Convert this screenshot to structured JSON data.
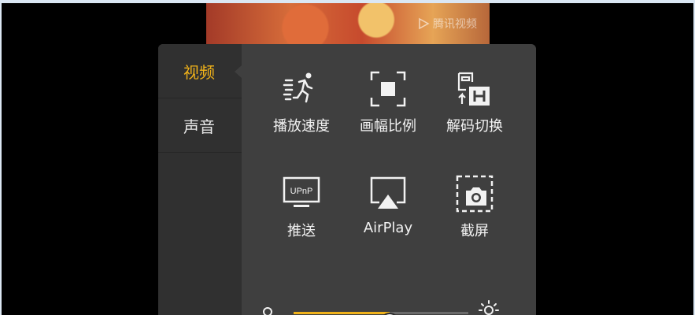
{
  "watermark": {
    "text": "腾讯视频"
  },
  "sidebar": {
    "items": [
      {
        "label": "视频",
        "active": true
      },
      {
        "label": "声音",
        "active": false
      }
    ]
  },
  "grid": {
    "items": [
      {
        "label": "播放速度",
        "icon": "running-person-icon"
      },
      {
        "label": "画幅比例",
        "icon": "aspect-ratio-icon"
      },
      {
        "label": "解码切换",
        "icon": "decode-switch-icon"
      },
      {
        "label": "推送",
        "icon": "upnp-icon",
        "icon_text": "UPnP"
      },
      {
        "label": "AirPlay",
        "icon": "airplay-icon"
      },
      {
        "label": "截屏",
        "icon": "screenshot-camera-icon"
      }
    ]
  },
  "brightness": {
    "level": 0.55
  },
  "colors": {
    "accent": "#f0b21a",
    "panel": "#3f3f3f",
    "sidebar": "#303030"
  }
}
